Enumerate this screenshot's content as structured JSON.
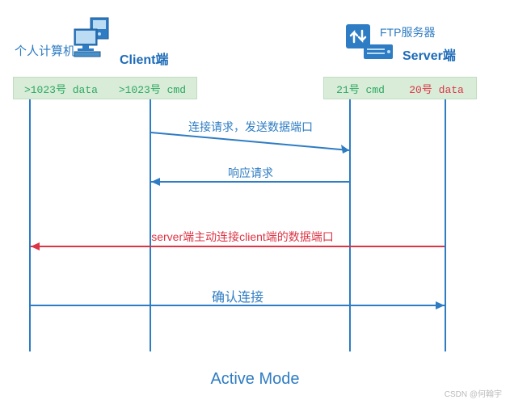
{
  "labels": {
    "client_cn": "个人计算机",
    "client_en": "Client端",
    "server_ftp": "FTP服务器",
    "server_en": "Server端"
  },
  "ports": {
    "client_data": ">1023号 data",
    "client_cmd": ">1023号 cmd",
    "server_cmd": "21号 cmd",
    "server_data": "20号 data"
  },
  "messages": {
    "m1": "连接请求，发送数据端口",
    "m2": "响应请求",
    "m3": "server端主动连接client端的数据端口",
    "m4": "确认连接"
  },
  "footer": "Active Mode",
  "watermark": "CSDN @何翰宇",
  "chart_data": {
    "type": "sequence_diagram",
    "title": "Active Mode",
    "participants": [
      {
        "role": "Client",
        "label_cn": "个人计算机",
        "label_en": "Client端",
        "lifelines": [
          {
            "name": "data",
            "port": ">1023"
          },
          {
            "name": "cmd",
            "port": ">1023"
          }
        ]
      },
      {
        "role": "Server",
        "label_cn": "FTP服务器",
        "label_en": "Server端",
        "lifelines": [
          {
            "name": "cmd",
            "port": "21"
          },
          {
            "name": "data",
            "port": "20"
          }
        ]
      }
    ],
    "messages": [
      {
        "from": "Client.cmd",
        "to": "Server.cmd",
        "text": "连接请求，发送数据端口",
        "color": "blue"
      },
      {
        "from": "Server.cmd",
        "to": "Client.cmd",
        "text": "响应请求",
        "color": "blue"
      },
      {
        "from": "Server.data",
        "to": "Client.data",
        "text": "server端主动连接client端的数据端口",
        "color": "red"
      },
      {
        "from": "Client.data",
        "to": "Server.data",
        "text": "确认连接",
        "color": "blue"
      }
    ]
  }
}
